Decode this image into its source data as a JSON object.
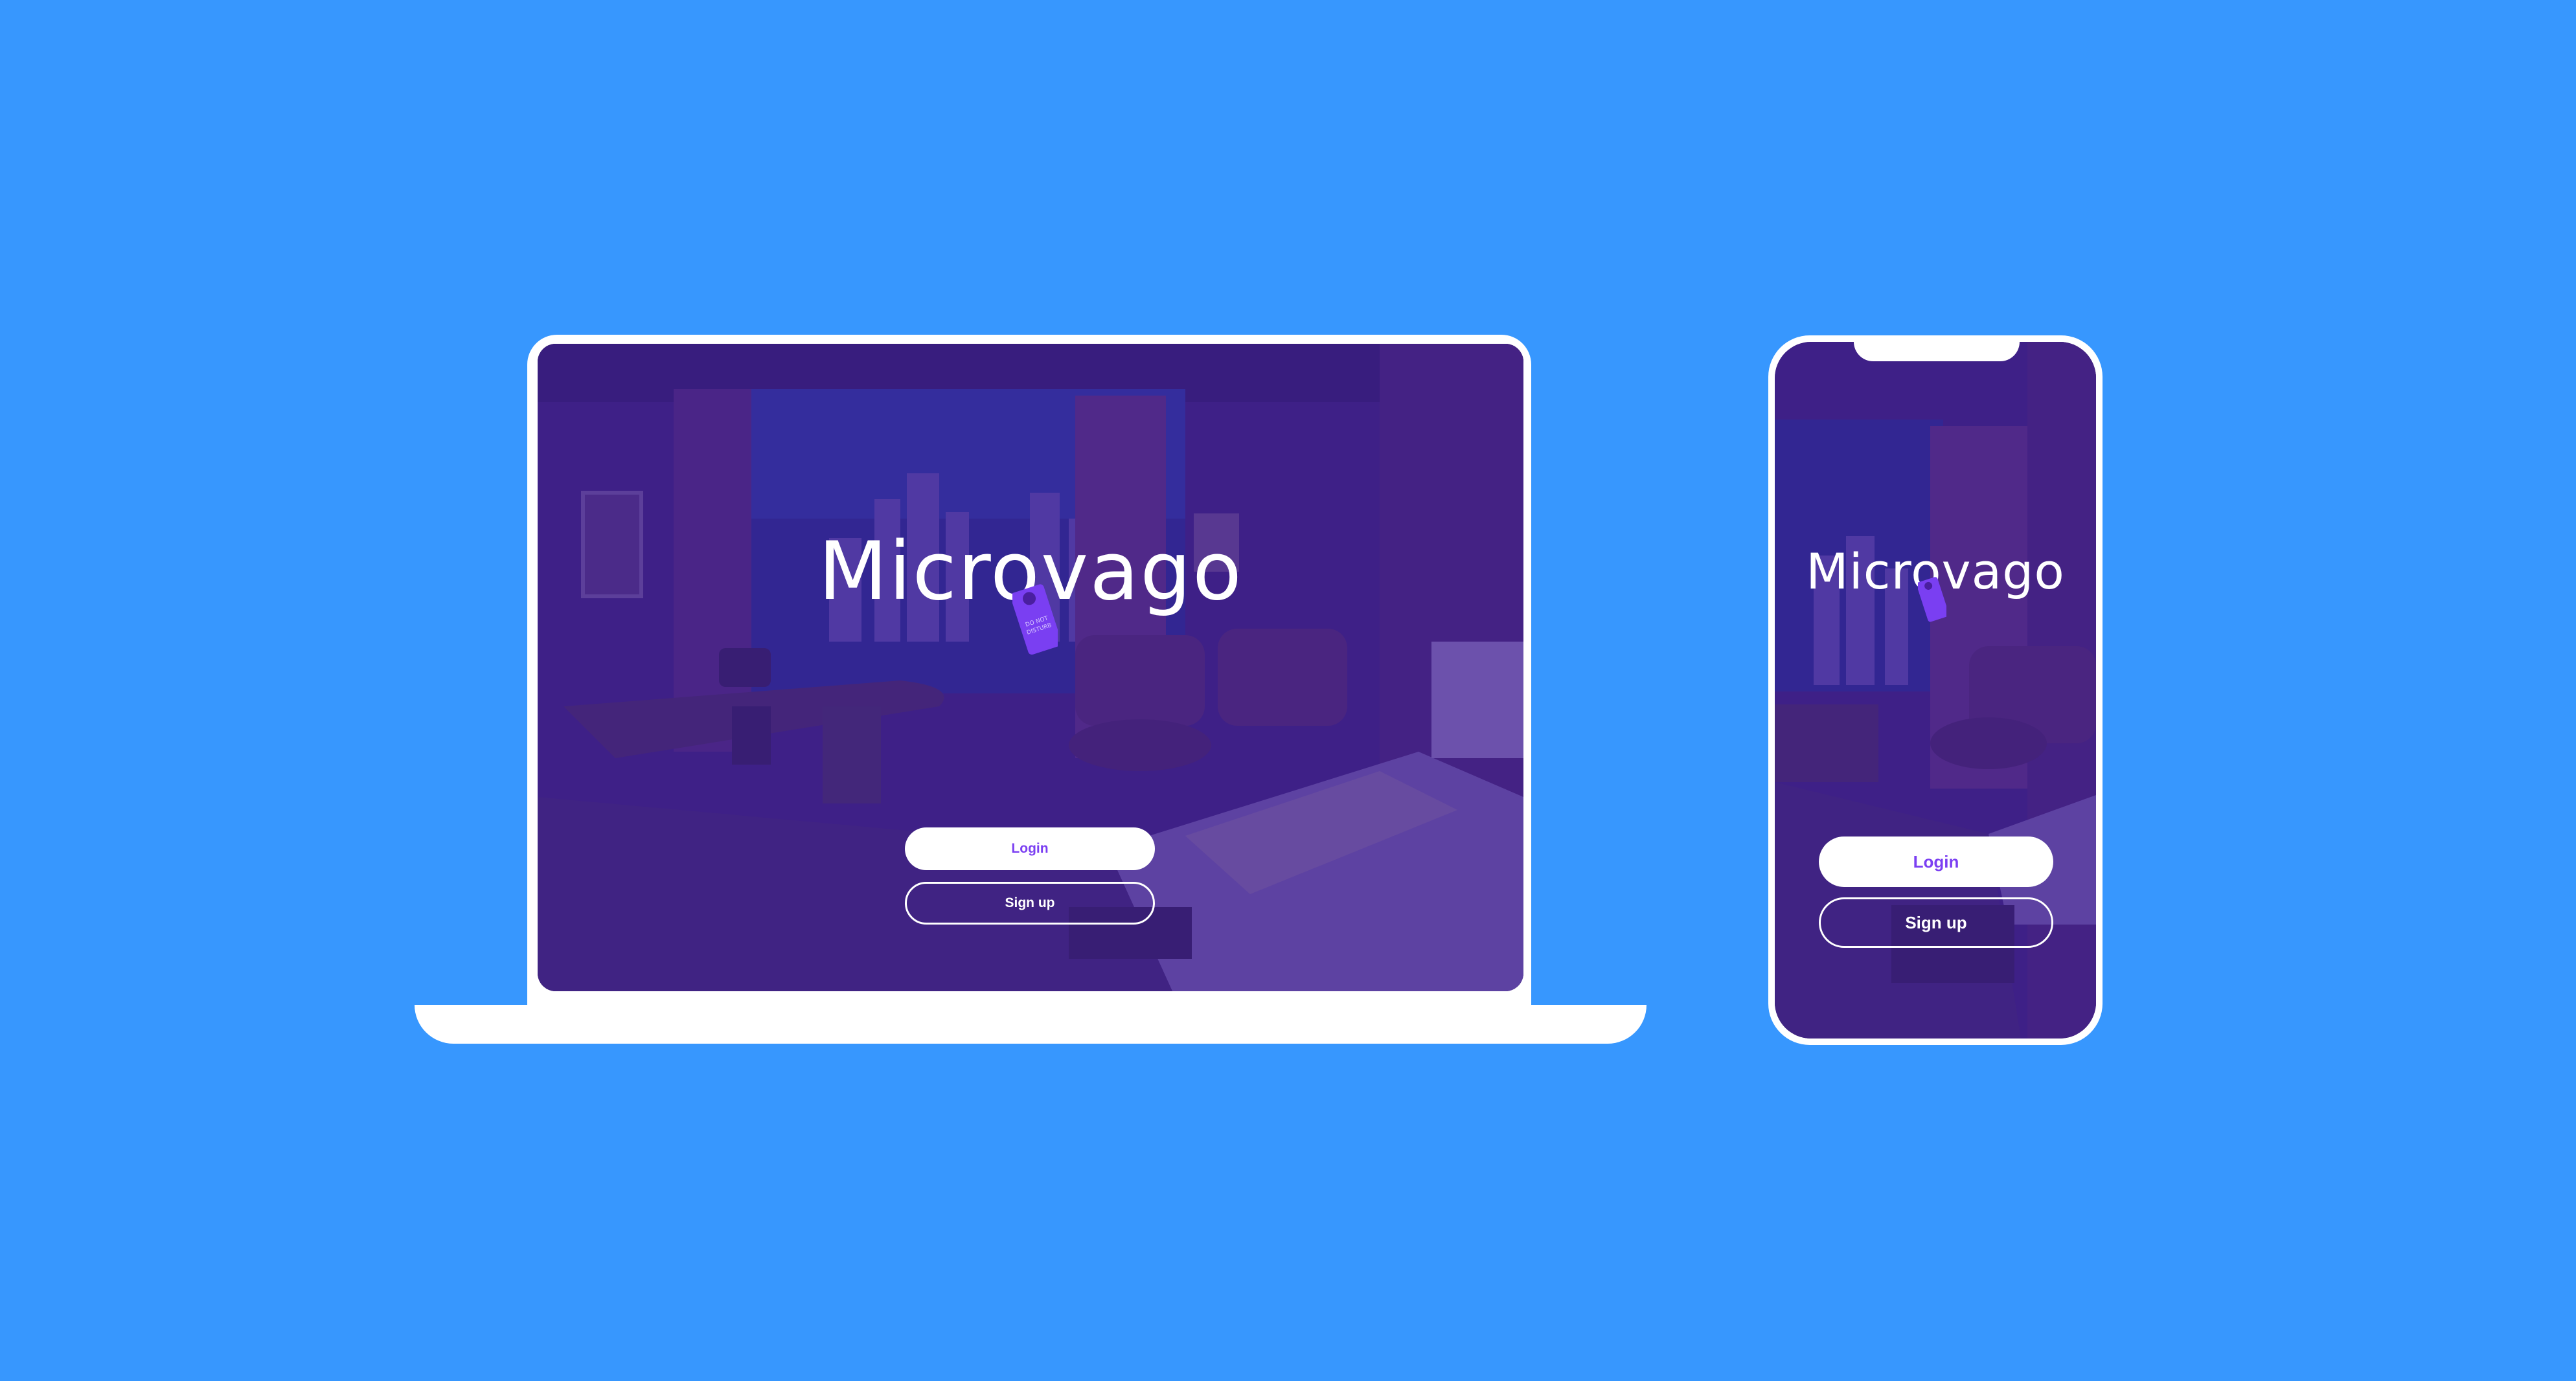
{
  "app": {
    "brand": "Microvago",
    "door_tag_text": "DO NOT DISTURB"
  },
  "colors": {
    "background": "#3797fe",
    "overlay": "#402296",
    "device_frame": "#ffffff",
    "accent": "#7b3ff2"
  },
  "laptop": {
    "login_label": "Login",
    "signup_label": "Sign up"
  },
  "phone": {
    "login_label": "Login",
    "signup_label": "Sign up"
  },
  "icons": {
    "door_tag": "door-hanger-icon"
  }
}
